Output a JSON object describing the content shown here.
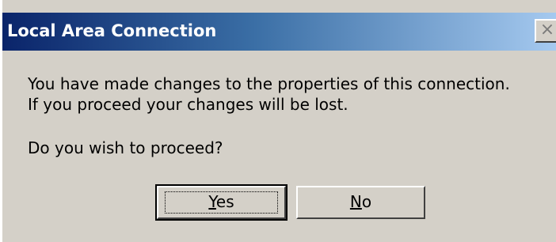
{
  "window": {
    "title": "Local Area Connection",
    "close_glyph": "×"
  },
  "message": {
    "line1": "You have made changes to the properties of this connection.",
    "line2": "If you proceed your changes will be lost.",
    "question": "Do you wish to proceed?"
  },
  "buttons": {
    "yes": {
      "mnemonic": "Y",
      "rest": "es"
    },
    "no": {
      "mnemonic": "N",
      "rest": "o"
    }
  },
  "colors": {
    "dialog_bg": "#d4d0c8",
    "titlebar_start": "#0a246a",
    "titlebar_end": "#a6caf0"
  },
  "icons": [
    "close-icon"
  ]
}
